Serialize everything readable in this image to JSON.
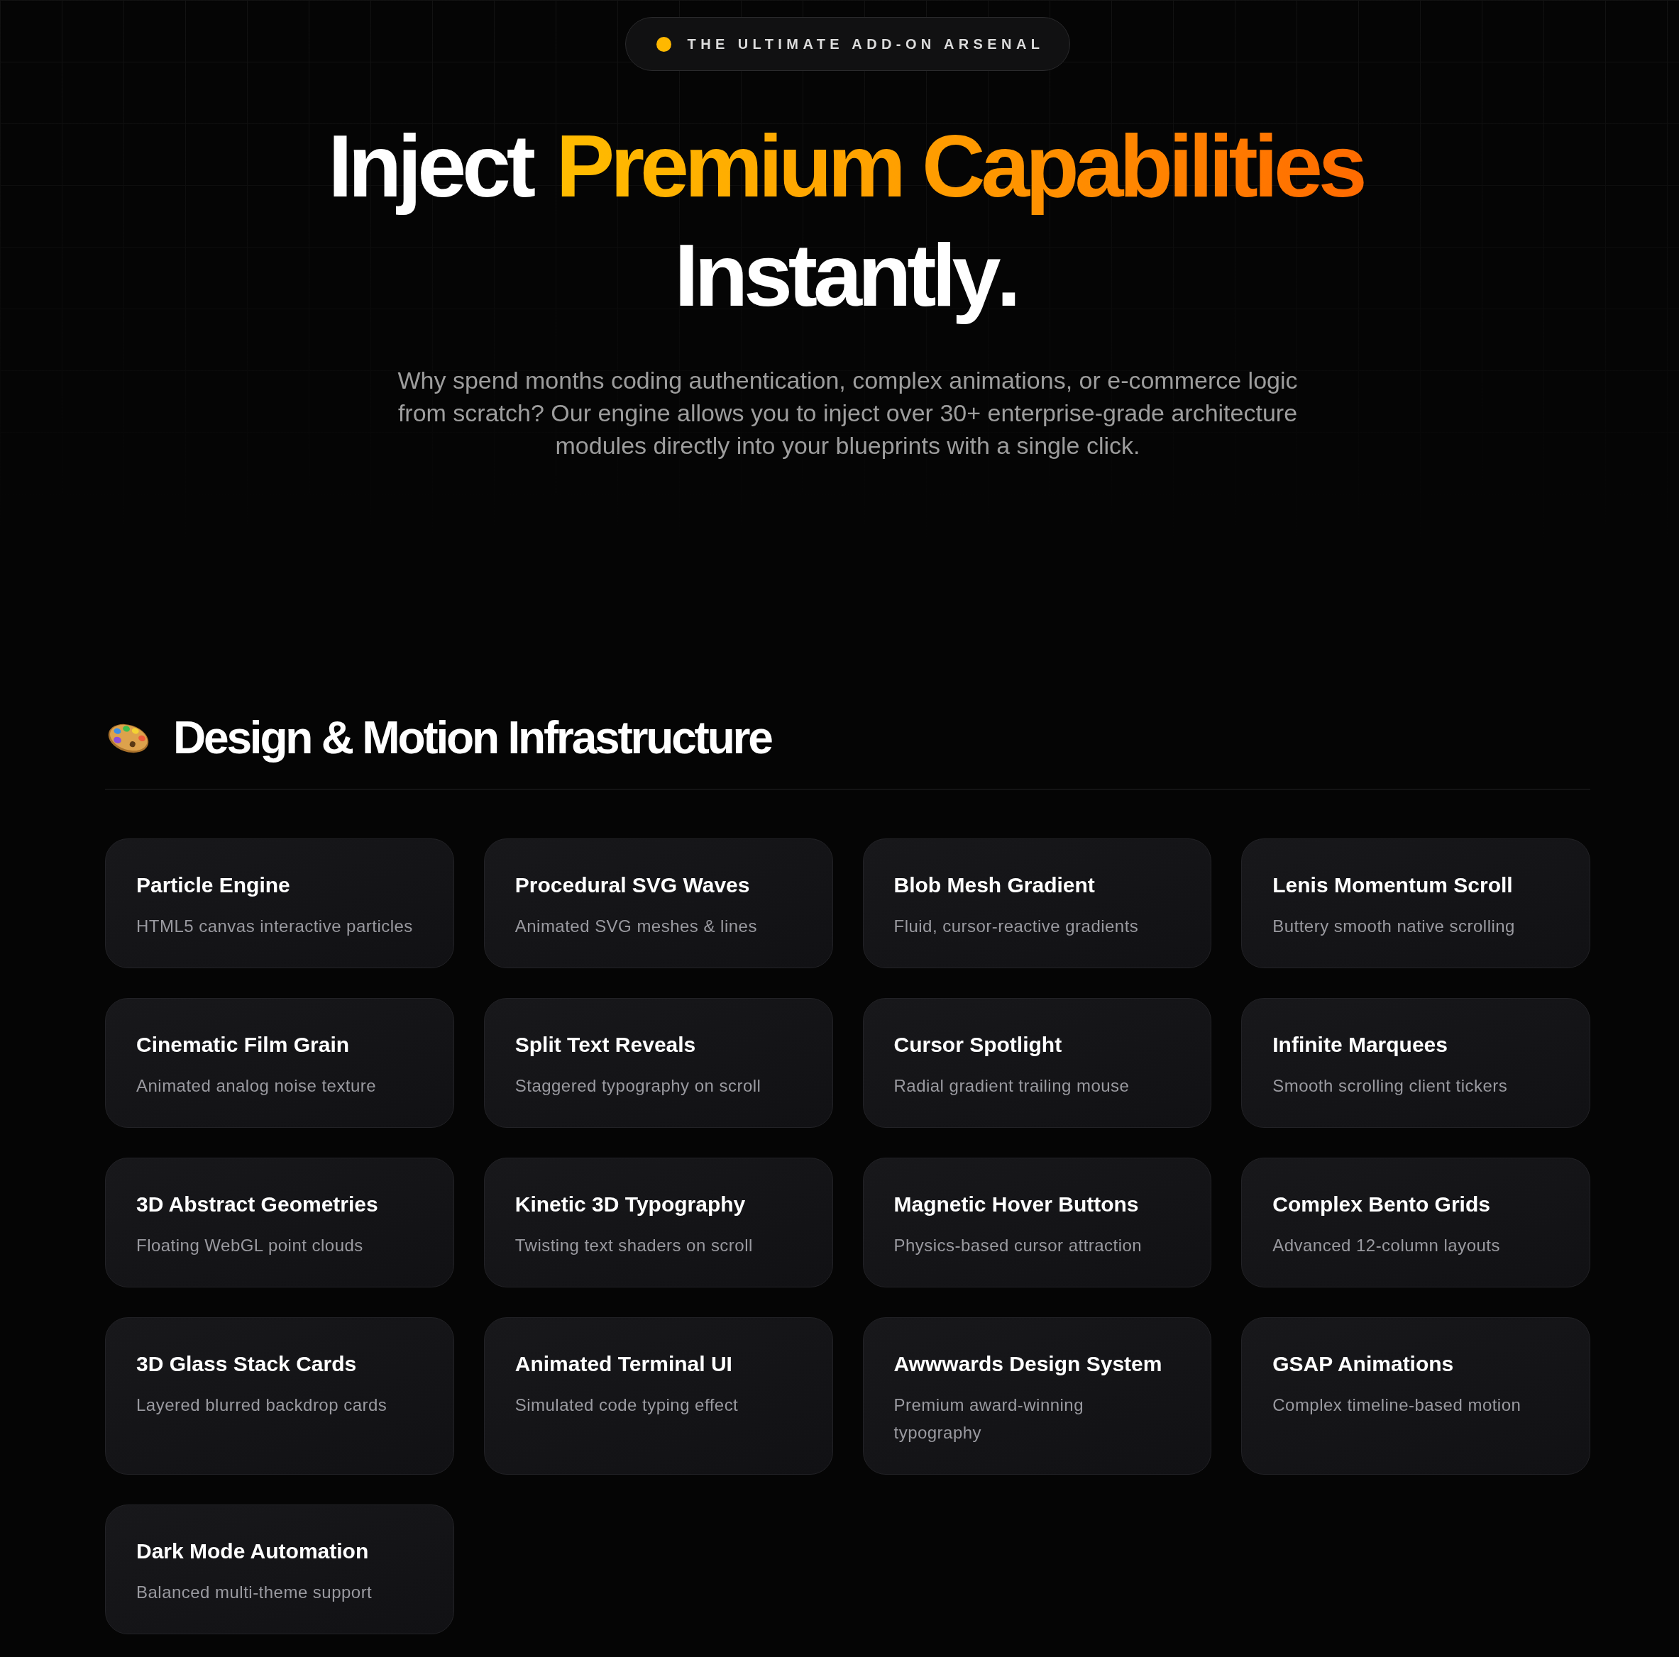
{
  "badge": {
    "text": "THE ULTIMATE ADD-ON ARSENAL"
  },
  "headline": {
    "parts": [
      {
        "text": "Inject",
        "highlight": false
      },
      {
        "text": "Premium Capabilities",
        "highlight": true
      },
      {
        "text": "Instantly.",
        "highlight": false
      }
    ]
  },
  "intro": "Why spend months coding authentication, complex animations, or e-commerce logic from scratch? Our engine allows you to inject over 30+ enterprise-grade architecture modules directly into your blueprints with a single click.",
  "section": {
    "title": "Design & Motion Infrastructure",
    "cards": [
      {
        "title": "Particle Engine",
        "description": "HTML5 canvas interactive particles"
      },
      {
        "title": "Procedural SVG Waves",
        "description": "Animated SVG meshes & lines"
      },
      {
        "title": "Blob Mesh Gradient",
        "description": "Fluid, cursor-reactive gradients"
      },
      {
        "title": "Lenis Momentum Scroll",
        "description": "Buttery smooth native scrolling"
      },
      {
        "title": "Cinematic Film Grain",
        "description": "Animated analog noise texture"
      },
      {
        "title": "Split Text Reveals",
        "description": "Staggered typography on scroll"
      },
      {
        "title": "Cursor Spotlight",
        "description": "Radial gradient trailing mouse"
      },
      {
        "title": "Infinite Marquees",
        "description": "Smooth scrolling client tickers"
      },
      {
        "title": "3D Abstract Geometries",
        "description": "Floating WebGL point clouds"
      },
      {
        "title": "Kinetic 3D Typography",
        "description": "Twisting text shaders on scroll"
      },
      {
        "title": "Magnetic Hover Buttons",
        "description": "Physics-based cursor attraction"
      },
      {
        "title": "Complex Bento Grids",
        "description": "Advanced 12-column layouts"
      },
      {
        "title": "3D Glass Stack Cards",
        "description": "Layered blurred backdrop cards"
      },
      {
        "title": "Animated Terminal UI",
        "description": "Simulated code typing effect"
      },
      {
        "title": "Awwwards Design System",
        "description": "Premium award-winning typography"
      },
      {
        "title": "GSAP Animations",
        "description": "Complex timeline-based motion"
      },
      {
        "title": "Dark Mode Automation",
        "description": "Balanced multi-theme support"
      }
    ]
  }
}
